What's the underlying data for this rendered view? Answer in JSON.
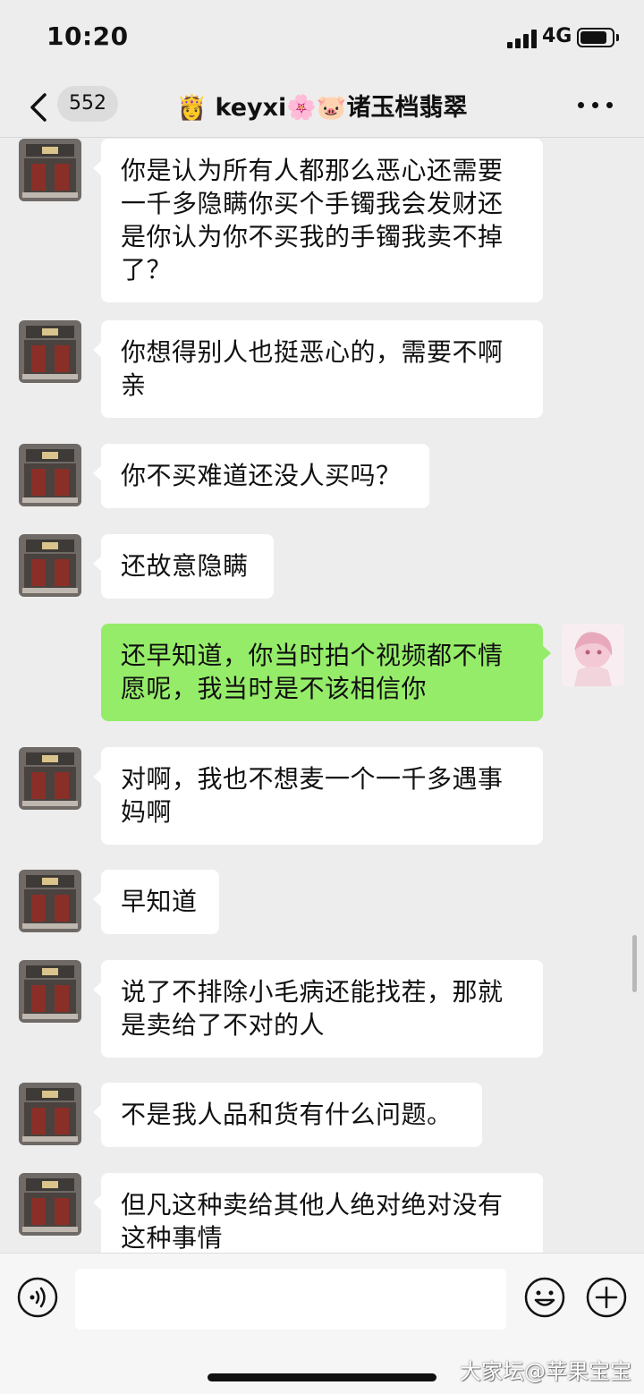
{
  "status_bar": {
    "time": "10:20",
    "network": "4G",
    "battery_level": 0.85
  },
  "nav": {
    "unread_count": "552",
    "title": "👸 keyxi🌸🐷诸玉档翡翠",
    "back_icon": "chevron-left-icon",
    "more_icon": "more-icon"
  },
  "messages": [
    {
      "side": "in",
      "text": "你是认为所有人都那么恶心还需要一千多隐瞒你买个手镯我会发财还是你认为你不买我的手镯我卖不掉了？"
    },
    {
      "side": "in",
      "text": "你想得别人也挺恶心的，需要不啊亲"
    },
    {
      "side": "in",
      "text": "你不买难道还没人买吗？"
    },
    {
      "side": "in",
      "text": "还故意隐瞒"
    },
    {
      "side": "out",
      "text": "还早知道，你当时拍个视频都不情愿呢，我当时是不该相信你"
    },
    {
      "side": "in",
      "text": "对啊，我也不想麦一个一千多遇事妈啊"
    },
    {
      "side": "in",
      "text": "早知道"
    },
    {
      "side": "in",
      "text": "说了不排除小毛病还能找茬，那就是卖给了不对的人"
    },
    {
      "side": "in",
      "text": "不是我人品和货有什么问题。"
    },
    {
      "side": "in",
      "text": "但凡这种卖给其他人绝对绝对没有这种事情"
    }
  ],
  "input_bar": {
    "voice_icon": "voice-icon",
    "emoji_icon": "emoji-icon",
    "plus_icon": "plus-icon",
    "input_value": ""
  },
  "watermark": "大家坛@苹果宝宝",
  "colors": {
    "background": "#ededed",
    "incoming_bubble": "#ffffff",
    "outgoing_bubble": "#95ec69"
  }
}
